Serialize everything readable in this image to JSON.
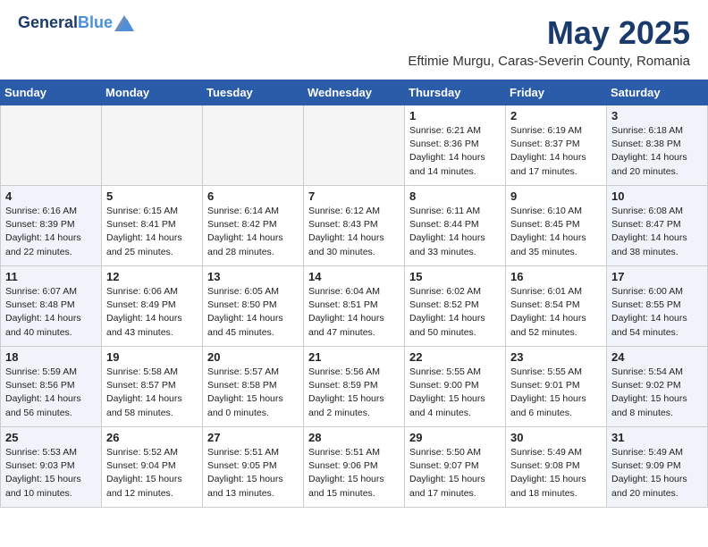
{
  "header": {
    "logo_line1": "General",
    "logo_line2": "Blue",
    "month_title": "May 2025",
    "subtitle": "Eftimie Murgu, Caras-Severin County, Romania"
  },
  "days_of_week": [
    "Sunday",
    "Monday",
    "Tuesday",
    "Wednesday",
    "Thursday",
    "Friday",
    "Saturday"
  ],
  "weeks": [
    [
      {
        "day": "",
        "info": ""
      },
      {
        "day": "",
        "info": ""
      },
      {
        "day": "",
        "info": ""
      },
      {
        "day": "",
        "info": ""
      },
      {
        "day": "1",
        "info": "Sunrise: 6:21 AM\nSunset: 8:36 PM\nDaylight: 14 hours\nand 14 minutes."
      },
      {
        "day": "2",
        "info": "Sunrise: 6:19 AM\nSunset: 8:37 PM\nDaylight: 14 hours\nand 17 minutes."
      },
      {
        "day": "3",
        "info": "Sunrise: 6:18 AM\nSunset: 8:38 PM\nDaylight: 14 hours\nand 20 minutes."
      }
    ],
    [
      {
        "day": "4",
        "info": "Sunrise: 6:16 AM\nSunset: 8:39 PM\nDaylight: 14 hours\nand 22 minutes."
      },
      {
        "day": "5",
        "info": "Sunrise: 6:15 AM\nSunset: 8:41 PM\nDaylight: 14 hours\nand 25 minutes."
      },
      {
        "day": "6",
        "info": "Sunrise: 6:14 AM\nSunset: 8:42 PM\nDaylight: 14 hours\nand 28 minutes."
      },
      {
        "day": "7",
        "info": "Sunrise: 6:12 AM\nSunset: 8:43 PM\nDaylight: 14 hours\nand 30 minutes."
      },
      {
        "day": "8",
        "info": "Sunrise: 6:11 AM\nSunset: 8:44 PM\nDaylight: 14 hours\nand 33 minutes."
      },
      {
        "day": "9",
        "info": "Sunrise: 6:10 AM\nSunset: 8:45 PM\nDaylight: 14 hours\nand 35 minutes."
      },
      {
        "day": "10",
        "info": "Sunrise: 6:08 AM\nSunset: 8:47 PM\nDaylight: 14 hours\nand 38 minutes."
      }
    ],
    [
      {
        "day": "11",
        "info": "Sunrise: 6:07 AM\nSunset: 8:48 PM\nDaylight: 14 hours\nand 40 minutes."
      },
      {
        "day": "12",
        "info": "Sunrise: 6:06 AM\nSunset: 8:49 PM\nDaylight: 14 hours\nand 43 minutes."
      },
      {
        "day": "13",
        "info": "Sunrise: 6:05 AM\nSunset: 8:50 PM\nDaylight: 14 hours\nand 45 minutes."
      },
      {
        "day": "14",
        "info": "Sunrise: 6:04 AM\nSunset: 8:51 PM\nDaylight: 14 hours\nand 47 minutes."
      },
      {
        "day": "15",
        "info": "Sunrise: 6:02 AM\nSunset: 8:52 PM\nDaylight: 14 hours\nand 50 minutes."
      },
      {
        "day": "16",
        "info": "Sunrise: 6:01 AM\nSunset: 8:54 PM\nDaylight: 14 hours\nand 52 minutes."
      },
      {
        "day": "17",
        "info": "Sunrise: 6:00 AM\nSunset: 8:55 PM\nDaylight: 14 hours\nand 54 minutes."
      }
    ],
    [
      {
        "day": "18",
        "info": "Sunrise: 5:59 AM\nSunset: 8:56 PM\nDaylight: 14 hours\nand 56 minutes."
      },
      {
        "day": "19",
        "info": "Sunrise: 5:58 AM\nSunset: 8:57 PM\nDaylight: 14 hours\nand 58 minutes."
      },
      {
        "day": "20",
        "info": "Sunrise: 5:57 AM\nSunset: 8:58 PM\nDaylight: 15 hours\nand 0 minutes."
      },
      {
        "day": "21",
        "info": "Sunrise: 5:56 AM\nSunset: 8:59 PM\nDaylight: 15 hours\nand 2 minutes."
      },
      {
        "day": "22",
        "info": "Sunrise: 5:55 AM\nSunset: 9:00 PM\nDaylight: 15 hours\nand 4 minutes."
      },
      {
        "day": "23",
        "info": "Sunrise: 5:55 AM\nSunset: 9:01 PM\nDaylight: 15 hours\nand 6 minutes."
      },
      {
        "day": "24",
        "info": "Sunrise: 5:54 AM\nSunset: 9:02 PM\nDaylight: 15 hours\nand 8 minutes."
      }
    ],
    [
      {
        "day": "25",
        "info": "Sunrise: 5:53 AM\nSunset: 9:03 PM\nDaylight: 15 hours\nand 10 minutes."
      },
      {
        "day": "26",
        "info": "Sunrise: 5:52 AM\nSunset: 9:04 PM\nDaylight: 15 hours\nand 12 minutes."
      },
      {
        "day": "27",
        "info": "Sunrise: 5:51 AM\nSunset: 9:05 PM\nDaylight: 15 hours\nand 13 minutes."
      },
      {
        "day": "28",
        "info": "Sunrise: 5:51 AM\nSunset: 9:06 PM\nDaylight: 15 hours\nand 15 minutes."
      },
      {
        "day": "29",
        "info": "Sunrise: 5:50 AM\nSunset: 9:07 PM\nDaylight: 15 hours\nand 17 minutes."
      },
      {
        "day": "30",
        "info": "Sunrise: 5:49 AM\nSunset: 9:08 PM\nDaylight: 15 hours\nand 18 minutes."
      },
      {
        "day": "31",
        "info": "Sunrise: 5:49 AM\nSunset: 9:09 PM\nDaylight: 15 hours\nand 20 minutes."
      }
    ]
  ],
  "weekend_cols": [
    0,
    6
  ],
  "empty_first_week": [
    0,
    1,
    2,
    3
  ]
}
